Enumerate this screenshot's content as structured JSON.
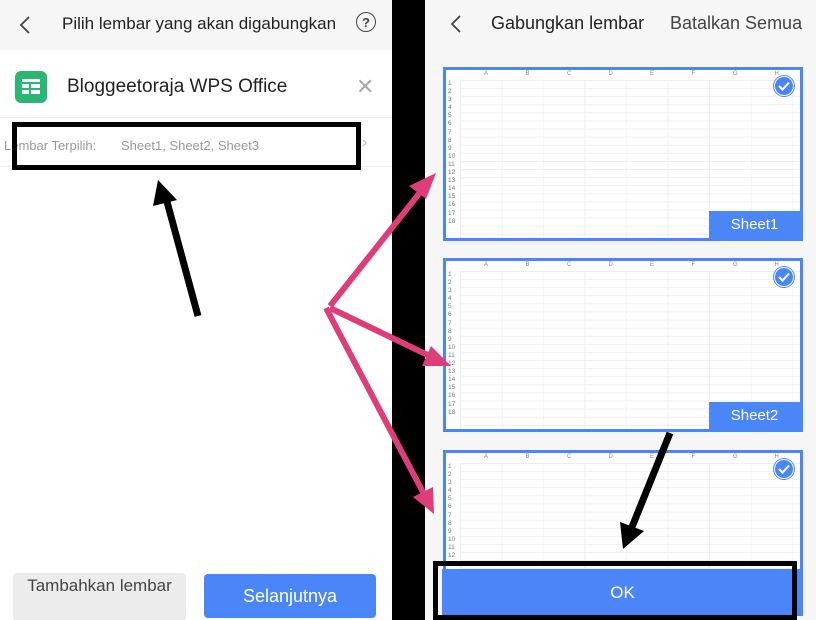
{
  "left": {
    "title": "Pilih lembar yang akan digabungkan",
    "file_name": "Bloggeetoraja WPS Office",
    "selected_label": "Lembar Terpilih:",
    "selected_value": "Sheet1, Sheet2, Sheet3",
    "add_button": "Tambahkan lembar",
    "next_button": "Selanjutnya"
  },
  "right": {
    "title": "Gabungkan lembar",
    "cancel_all": "Batalkan Semua",
    "columns": [
      "A",
      "B",
      "C",
      "D",
      "E",
      "F",
      "G",
      "H"
    ],
    "sheets": [
      {
        "name": "Sheet1",
        "checked": true
      },
      {
        "name": "Sheet2",
        "checked": true
      },
      {
        "name": "",
        "checked": true
      }
    ],
    "ok_button": "OK"
  },
  "colors": {
    "accent": "#4a86f7",
    "file_icon": "#2bb673",
    "annotation_arrow_pink": "#dd3e7a",
    "annotation_arrow_black": "#000000"
  }
}
